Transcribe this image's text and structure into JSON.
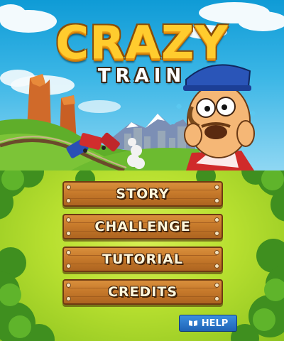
{
  "game": {
    "title_main": "CRAZY",
    "title_sub": "TRAIN"
  },
  "menu": {
    "items": [
      {
        "label": "STORY"
      },
      {
        "label": "CHALLENGE"
      },
      {
        "label": "TUTORIAL"
      },
      {
        "label": "CREDITS"
      }
    ]
  },
  "help": {
    "label": "HELP",
    "icon": "book-icon"
  },
  "colors": {
    "title": "#ffcc2e",
    "plank": "#c77a2b",
    "help_button": "#2a74cc",
    "grass": "#b8e030"
  }
}
